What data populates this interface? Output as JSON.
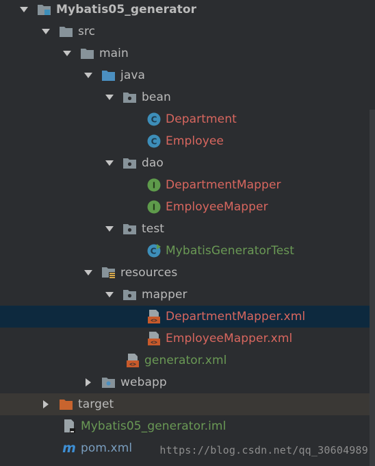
{
  "project_tree": {
    "nodes": [
      {
        "label": "Mybatis05_generator",
        "icon": "module-folder-icon",
        "expanded": true
      },
      {
        "label": "src",
        "icon": "folder-icon",
        "expanded": true
      },
      {
        "label": "main",
        "icon": "folder-icon",
        "expanded": true
      },
      {
        "label": "java",
        "icon": "source-folder-icon",
        "expanded": true
      },
      {
        "label": "bean",
        "icon": "package-icon",
        "expanded": true
      },
      {
        "label": "Department",
        "icon": "class-icon"
      },
      {
        "label": "Employee",
        "icon": "class-icon"
      },
      {
        "label": "dao",
        "icon": "package-icon",
        "expanded": true
      },
      {
        "label": "DepartmentMapper",
        "icon": "interface-icon"
      },
      {
        "label": "EmployeeMapper",
        "icon": "interface-icon"
      },
      {
        "label": "test",
        "icon": "package-icon",
        "expanded": true
      },
      {
        "label": "MybatisGeneratorTest",
        "icon": "runnable-class-icon"
      },
      {
        "label": "resources",
        "icon": "resources-folder-icon",
        "expanded": true
      },
      {
        "label": "mapper",
        "icon": "package-icon",
        "expanded": true
      },
      {
        "label": "DepartmentMapper.xml",
        "icon": "xml-file-icon",
        "selected": true
      },
      {
        "label": "EmployeeMapper.xml",
        "icon": "xml-file-icon"
      },
      {
        "label": "generator.xml",
        "icon": "xml-file-icon"
      },
      {
        "label": "webapp",
        "icon": "web-folder-icon",
        "expanded": false
      },
      {
        "label": "target",
        "icon": "excluded-folder-icon",
        "expanded": false
      },
      {
        "label": "Mybatis05_generator.iml",
        "icon": "iml-file-icon"
      },
      {
        "label": "pom.xml",
        "icon": "maven-icon"
      }
    ]
  },
  "watermark": "https://blog.csdn.net/qq_30604989",
  "colors": {
    "background": "#2b2d30",
    "selection": "#0d293e",
    "text_default": "#bbbbbb",
    "text_modified": "#d9675f",
    "text_added": "#6a9955",
    "folder": "#87939a",
    "source_folder": "#4b8fc0",
    "class_icon": "#3d8eb9",
    "interface_icon": "#5e9a4b",
    "xml_icon": "#c85a2b",
    "excluded_folder": "#c8642e",
    "maven": "#3e8fd4"
  }
}
